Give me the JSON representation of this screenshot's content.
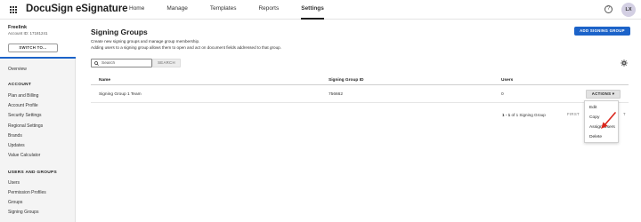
{
  "header": {
    "brand": "DocuSign eSignature",
    "tabs": [
      {
        "label": "Home"
      },
      {
        "label": "Manage"
      },
      {
        "label": "Templates"
      },
      {
        "label": "Reports"
      },
      {
        "label": "Settings",
        "active": true
      }
    ],
    "help_icon": "?",
    "avatar_initials": "LX"
  },
  "sidebar": {
    "account_name": "Freelink",
    "account_id": "Account ID: 17181241",
    "switch_button": "SWITCH TO...",
    "overview": "Overview",
    "account_section": {
      "title": "ACCOUNT",
      "items": [
        "Plan and Billing",
        "Account Profile",
        "Security Settings",
        "Regional Settings",
        "Brands",
        "Updates",
        "Value Calculator"
      ]
    },
    "users_section": {
      "title": "USERS AND GROUPS",
      "items": [
        "Users",
        "Permission Profiles",
        "Groups",
        "Signing Groups"
      ]
    }
  },
  "main": {
    "title": "Signing Groups",
    "description_1": "Create new signing groups and manage group membership.",
    "description_2": "Adding users to a signing group allows them to open and act on document fields addressed to that group.",
    "add_button": "ADD SIGNING GROUP",
    "search": {
      "placeholder": "Search",
      "button": "SEARCH"
    },
    "table": {
      "columns": [
        "Name",
        "Signing Group ID",
        "Users"
      ],
      "rows": [
        {
          "name": "Signing Group 1 Team",
          "id": "756662",
          "users": "0",
          "action": "ACTIONS"
        }
      ]
    },
    "pagination": {
      "range": "1 - 1",
      "summary": "of 1 Signing Group",
      "first": "FIRST",
      "truncated": "T"
    },
    "actions_menu": [
      "Edit",
      "Copy",
      "Assign Users",
      "Delete"
    ]
  },
  "colors": {
    "accent": "#1c63c9",
    "annotation_arrow": "#d9261c"
  }
}
